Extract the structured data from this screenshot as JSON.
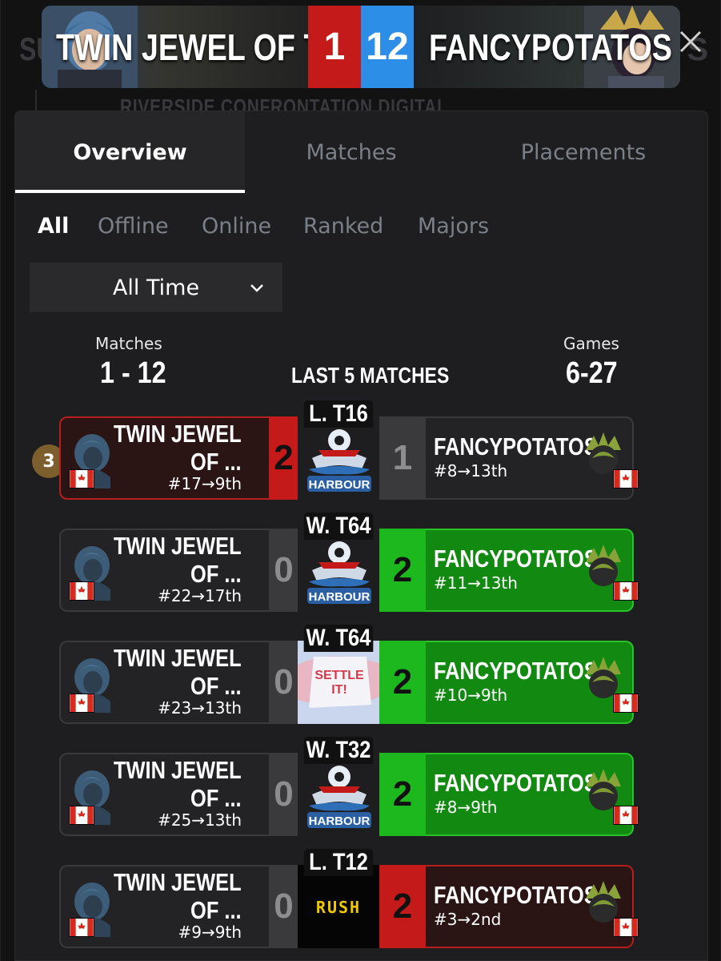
{
  "background": {
    "title_left": "SU",
    "subtitle": "RIVERSIDE CONFRONTATION DIGITAL",
    "title_right": "S"
  },
  "header": {
    "player1_name": "TWIN JEWEL OF T...",
    "player1_score": "1",
    "player2_score": "12",
    "player2_name": "FANCYPOTATOS",
    "colors": {
      "p1": "#c41a1a",
      "p2": "#2d8ee8"
    }
  },
  "tabs": [
    "Overview",
    "Matches",
    "Placements"
  ],
  "active_tab": "Overview",
  "filters": [
    "All",
    "Offline",
    "Online",
    "Ranked",
    "Majors"
  ],
  "active_filter": "All",
  "time_dropdown": {
    "value": "All Time"
  },
  "stats": {
    "matches_label": "Matches",
    "matches_value": "1 - 12",
    "last5_label": "LAST 5 MATCHES",
    "games_label": "Games",
    "games_value": "6-27"
  },
  "badge": "3",
  "matches": [
    {
      "round": "L. T16",
      "p1_name_1": "TWIN JEWEL",
      "p1_name_2": "OF ...",
      "p1_seed": "#17→9th",
      "p1_score": "2",
      "event_logo": "harbour",
      "p2_score": "1",
      "p2_name": "FANCYPOTATOS",
      "p2_seed": "#8→13th",
      "winner": "p1"
    },
    {
      "round": "W. T64",
      "p1_name_1": "TWIN JEWEL",
      "p1_name_2": "OF ...",
      "p1_seed": "#22→17th",
      "p1_score": "0",
      "event_logo": "harbour",
      "p2_score": "2",
      "p2_name": "FANCYPOTATOS",
      "p2_seed": "#11→13th",
      "winner": "p2"
    },
    {
      "round": "W. T64",
      "p1_name_1": "TWIN JEWEL",
      "p1_name_2": "OF ...",
      "p1_seed": "#23→13th",
      "p1_score": "0",
      "event_logo": "settle-it",
      "event_text": "SETTLE IT!",
      "p2_score": "2",
      "p2_name": "FANCYPOTATOS",
      "p2_seed": "#10→9th",
      "winner": "p2"
    },
    {
      "round": "W. T32",
      "p1_name_1": "TWIN JEWEL",
      "p1_name_2": "OF ...",
      "p1_seed": "#25→13th",
      "p1_score": "0",
      "event_logo": "harbour",
      "p2_score": "2",
      "p2_name": "FANCYPOTATOS",
      "p2_seed": "#8→9th",
      "winner": "p2"
    },
    {
      "round": "L. T12",
      "p1_name_1": "TWIN JEWEL",
      "p1_name_2": "OF ...",
      "p1_seed": "#9→9th",
      "p1_score": "0",
      "event_logo": "rush",
      "event_text": "RUSH",
      "p2_score": "2",
      "p2_name": "FANCYPOTATOS",
      "p2_seed": "#3→2nd",
      "winner": "p2-lost"
    }
  ],
  "harbour_text": "HARBOUR"
}
